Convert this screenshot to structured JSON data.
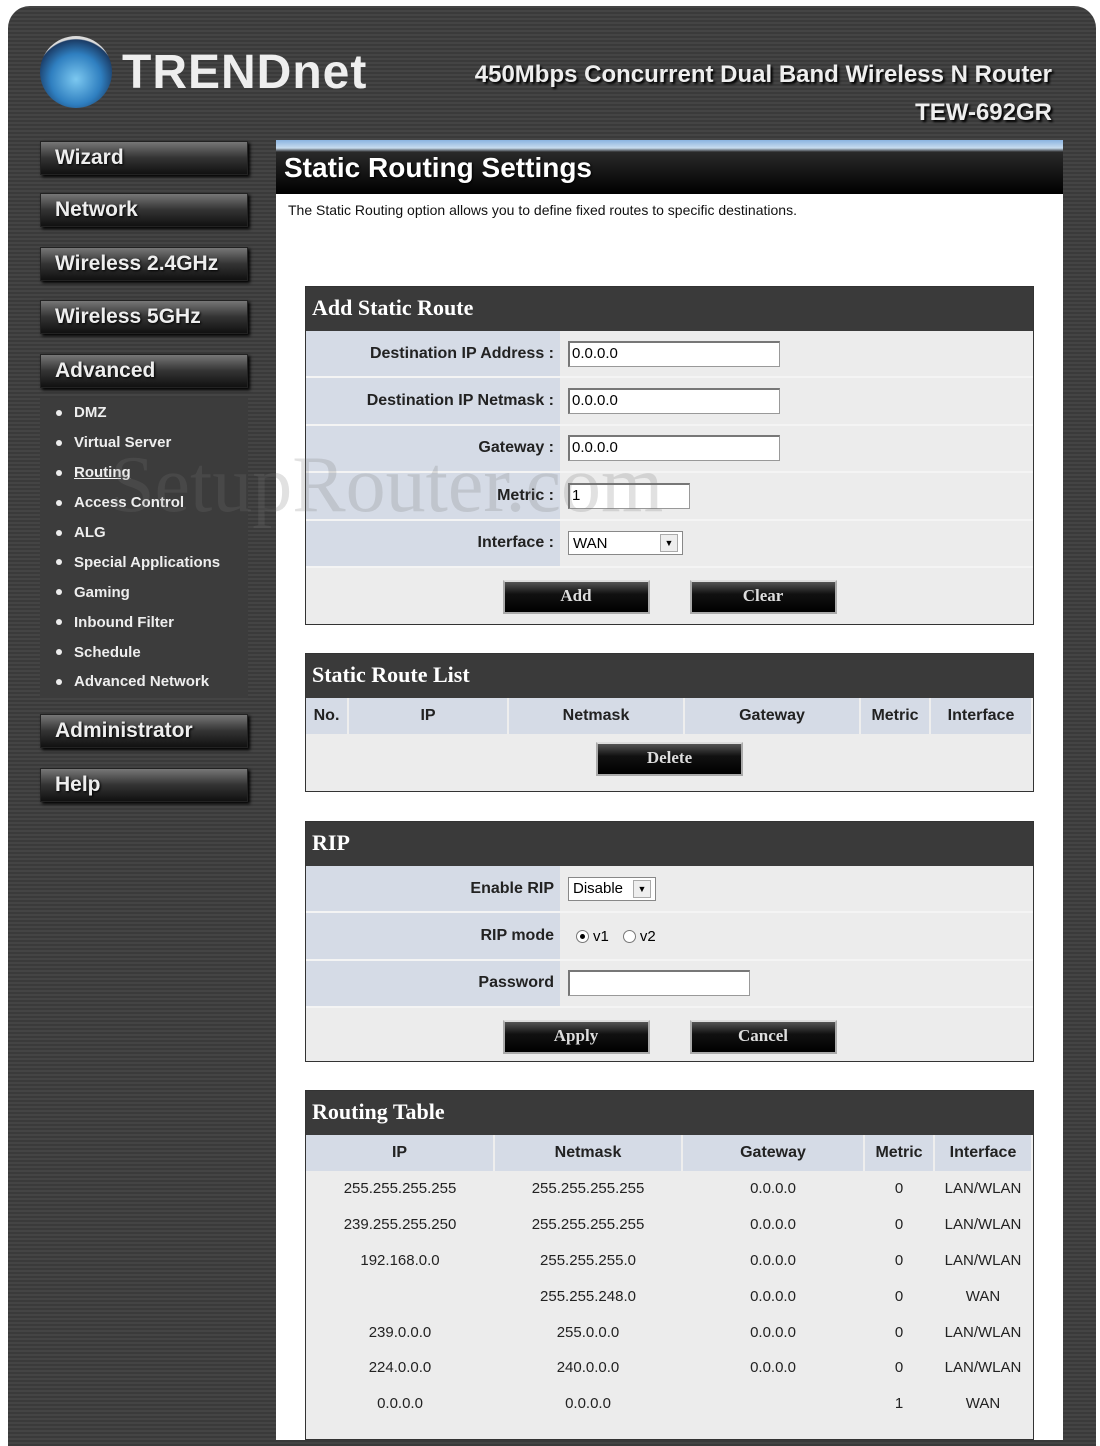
{
  "header": {
    "brand": "TRENDnet",
    "product": "450Mbps Concurrent Dual Band Wireless N Router",
    "model": "TEW-692GR"
  },
  "sidebar": {
    "items": [
      "Wizard",
      "Network",
      "Wireless 2.4GHz",
      "Wireless 5GHz",
      "Advanced",
      "Administrator",
      "Help"
    ],
    "submenu": [
      "DMZ",
      "Virtual Server",
      "Routing",
      "Access Control",
      "ALG",
      "Special Applications",
      "Gaming",
      "Inbound Filter",
      "Schedule",
      "Advanced Network"
    ],
    "active_sub": "Routing"
  },
  "page": {
    "title": "Static Routing Settings",
    "intro": "The Static Routing option allows you to define fixed routes to specific destinations."
  },
  "add_route": {
    "title": "Add Static Route",
    "dest_ip_label": "Destination IP Address :",
    "dest_ip": "0.0.0.0",
    "netmask_label": "Destination IP Netmask :",
    "netmask": "0.0.0.0",
    "gateway_label": "Gateway :",
    "gateway": "0.0.0.0",
    "metric_label": "Metric :",
    "metric": "1",
    "interface_label": "Interface :",
    "interface": "WAN",
    "add": "Add",
    "clear": "Clear"
  },
  "route_list": {
    "title": "Static Route List",
    "columns": [
      "No.",
      "IP",
      "Netmask",
      "Gateway",
      "Metric",
      "Interface"
    ],
    "delete": "Delete"
  },
  "rip": {
    "title": "RIP",
    "enable_label": "Enable RIP",
    "enable": "Disable",
    "mode_label": "RIP mode",
    "v1": "v1",
    "v2": "v2",
    "mode_selected": "v1",
    "password_label": "Password",
    "password": "",
    "apply": "Apply",
    "cancel": "Cancel"
  },
  "routing_table": {
    "title": "Routing Table",
    "columns": [
      "IP",
      "Netmask",
      "Gateway",
      "Metric",
      "Interface"
    ],
    "rows": [
      [
        "255.255.255.255",
        "255.255.255.255",
        "0.0.0.0",
        "0",
        "LAN/WLAN"
      ],
      [
        "239.255.255.250",
        "255.255.255.255",
        "0.0.0.0",
        "0",
        "LAN/WLAN"
      ],
      [
        "192.168.0.0",
        "255.255.255.0",
        "0.0.0.0",
        "0",
        "LAN/WLAN"
      ],
      [
        "",
        "255.255.248.0",
        "0.0.0.0",
        "0",
        "WAN"
      ],
      [
        "239.0.0.0",
        "255.0.0.0",
        "0.0.0.0",
        "0",
        "LAN/WLAN"
      ],
      [
        "224.0.0.0",
        "240.0.0.0",
        "0.0.0.0",
        "0",
        "LAN/WLAN"
      ],
      [
        "0.0.0.0",
        "0.0.0.0",
        "",
        "1",
        "WAN"
      ]
    ]
  },
  "watermark": "SetupRouter.com"
}
